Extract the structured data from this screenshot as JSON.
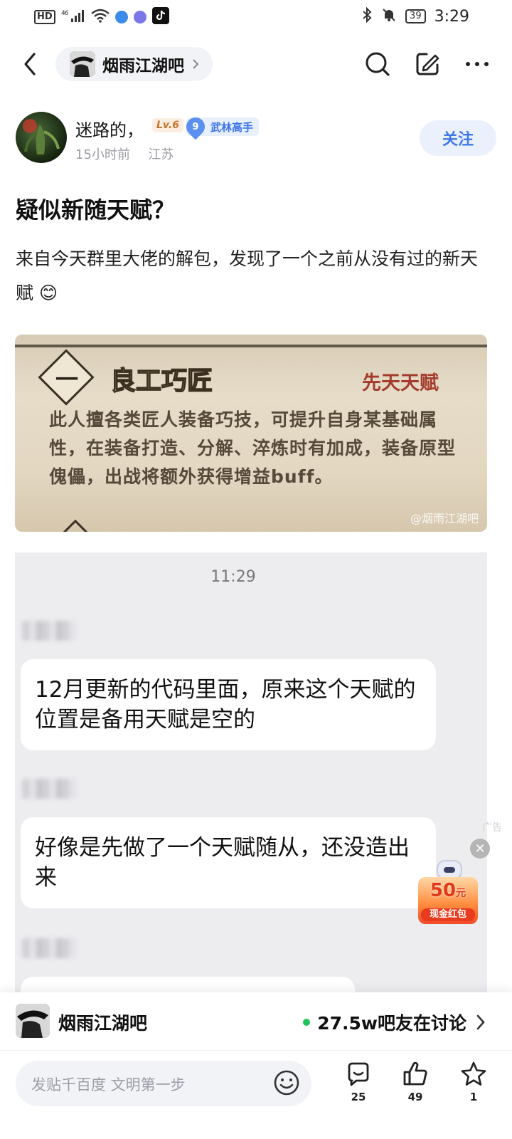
{
  "status_bar": {
    "hd": "HD",
    "network": "46",
    "battery": "39",
    "time": "3:29",
    "icons": [
      "hd-icon",
      "signal-icon",
      "wifi-icon",
      "app-blue-icon",
      "music-icon",
      "tiktok-icon",
      "bluetooth-icon",
      "mute-icon",
      "battery-icon"
    ]
  },
  "nav": {
    "forum_name": "烟雨江湖吧",
    "icons": [
      "back-icon",
      "search-icon",
      "edit-icon",
      "more-icon"
    ]
  },
  "author": {
    "name": "迷路的，",
    "level": "Lv.6",
    "title_num": "9",
    "title": "武林高手",
    "time": "15小时前",
    "location": "江苏",
    "follow_label": "关注"
  },
  "post": {
    "title": "疑似新随天赋？",
    "body": "来自今天群里大佬的解包，发现了一个之前从没有过的新天赋",
    "emoji": "😊"
  },
  "game_image": {
    "glyph": "一",
    "name": "良工巧匠",
    "tag": "先天天赋",
    "description": "此人擅各类匠人装备巧技，可提升自身某基础属性，在装备打造、分解、淬炼时有加成，装备原型傀儡，出战将额外获得增益buff。",
    "watermark": "@烟雨江湖吧"
  },
  "chat": {
    "time": "11:29",
    "messages": [
      "12月更新的代码里面，原来这个天赋的位置是备用天赋是空的",
      "好像是先做了一个天赋随从，还没造出来"
    ]
  },
  "ad": {
    "label": "广告",
    "amount": "50",
    "unit": "元",
    "caption": "现金红包"
  },
  "forum_bar": {
    "name": "烟雨江湖吧",
    "discussion": "27.5w吧友在讨论"
  },
  "action_bar": {
    "placeholder": "发贴千百度 文明第一步",
    "comments": "25",
    "likes": "49",
    "favorites": "1"
  },
  "colors": {
    "accent": "#3f78e8",
    "online": "#21c35b"
  }
}
